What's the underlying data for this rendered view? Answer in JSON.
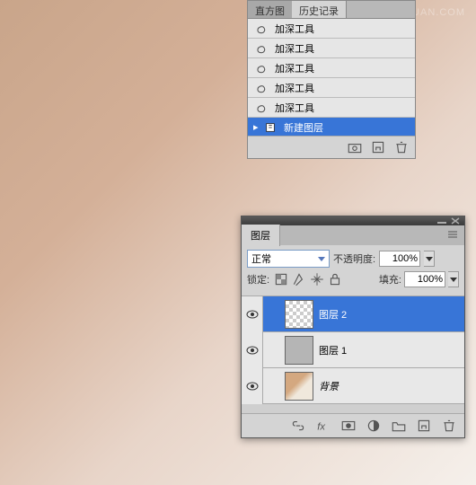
{
  "watermark": "WWW.MISSYUAN.COM",
  "history": {
    "tab_inactive": "直方图",
    "tab_active": "历史记录",
    "items": [
      {
        "label": "加深工具",
        "selected": false
      },
      {
        "label": "加深工具",
        "selected": false
      },
      {
        "label": "加深工具",
        "selected": false
      },
      {
        "label": "加深工具",
        "selected": false
      },
      {
        "label": "加深工具",
        "selected": false
      },
      {
        "label": "新建图层",
        "selected": true
      }
    ]
  },
  "layers": {
    "tab": "图层",
    "blend_mode": "正常",
    "opacity_label": "不透明度:",
    "opacity_value": "100%",
    "lock_label": "锁定:",
    "fill_label": "填充:",
    "fill_value": "100%",
    "items": [
      {
        "name": "图层 2",
        "thumb": "checker",
        "selected": true,
        "italic": false
      },
      {
        "name": "图层 1",
        "thumb": "gray",
        "selected": false,
        "italic": false
      },
      {
        "name": "背景",
        "thumb": "img",
        "selected": false,
        "italic": true
      }
    ]
  }
}
